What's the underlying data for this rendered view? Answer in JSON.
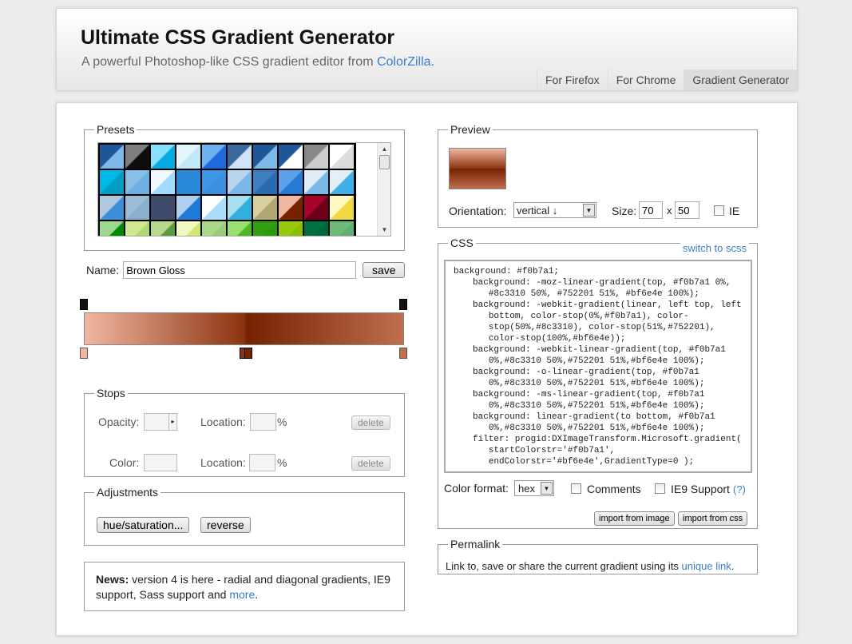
{
  "header": {
    "title": "Ultimate CSS Gradient Generator",
    "subtitle": "A powerful Photoshop-like CSS gradient editor from ",
    "subtitle_link": "ColorZilla",
    "subtitle_end": ".",
    "nav": [
      "For Firefox",
      "For Chrome",
      "Gradient Generator"
    ]
  },
  "presets": {
    "legend": "Presets",
    "swatches": [
      [
        "#1e5799",
        "#7db9e8"
      ],
      [
        "#7d7e7d",
        "#0e0e0e"
      ],
      [
        "#87e0fd",
        "#05abe0"
      ],
      [
        "#e4f5fc",
        "#bfe8f9"
      ],
      [
        "#6db3f2",
        "#1e69de"
      ],
      [
        "#3b679e",
        "#d0e4f7"
      ],
      [
        "#1e5799",
        "#7db9e8"
      ],
      [
        "#1e5799",
        "#ffffff"
      ],
      [
        "#888888",
        "#cccccc"
      ],
      [
        "#ffffff",
        "#dddddd"
      ],
      [
        "#00b7ea",
        "#009ec3"
      ],
      [
        "#88bfe8",
        "#70b0e0"
      ],
      [
        "#f0f9ff",
        "#a1dbff"
      ],
      [
        "#2989d8",
        "#2989d8"
      ],
      [
        "#3c96e8",
        "#3c8ee0"
      ],
      [
        "#b8d4ef",
        "#7ab8e8"
      ],
      [
        "#3b7fc0",
        "#2a6ab0"
      ],
      [
        "#5ba0e8",
        "#2878d8"
      ],
      [
        "#e0ecf8",
        "#7ab8e8"
      ],
      [
        "#e4f0f8",
        "#40b0e8"
      ],
      [
        "#b0c8e0",
        "#3a8ed8"
      ],
      [
        "#9cbdd8",
        "#8ab0d0"
      ],
      [
        "#3e4b6a",
        "#3e4b6a"
      ],
      [
        "#b0d0f0",
        "#1e7ad8"
      ],
      [
        "#ffffff",
        "#a8def8"
      ],
      [
        "#a8e0f0",
        "#30b0e0"
      ],
      [
        "#d8d0a0",
        "#b0a870"
      ],
      [
        "#f0b7a1",
        "#752201"
      ],
      [
        "#a90329",
        "#6d0019"
      ],
      [
        "#fff8c0",
        "#f0d840"
      ],
      [
        "#9dd890",
        "#008a00"
      ],
      [
        "#d0e890",
        "#b0d870"
      ],
      [
        "#b8d890",
        "#5a9a3a"
      ],
      [
        "#f0fac0",
        "#d0e870"
      ],
      [
        "#a8d888",
        "#98cc78"
      ],
      [
        "#98e070",
        "#50b820"
      ],
      [
        "#30a010",
        "#2a9a0a"
      ],
      [
        "#98c808",
        "#88c000"
      ],
      [
        "#007040",
        "#006838"
      ],
      [
        "#6cbc78",
        "#60b070"
      ]
    ]
  },
  "name": {
    "label": "Name:",
    "value": "Brown Gloss",
    "save": "save"
  },
  "gradient": {
    "stops": [
      {
        "color": "#f0b7a1",
        "pos": 0
      },
      {
        "color": "#8c3310",
        "pos": 50
      },
      {
        "color": "#752201",
        "pos": 51
      },
      {
        "color": "#bf6e4e",
        "pos": 100
      }
    ]
  },
  "stops": {
    "legend": "Stops",
    "opacity": "Opacity:",
    "location": "Location:",
    "color": "Color:",
    "pct": "%",
    "delete": "delete"
  },
  "adjustments": {
    "legend": "Adjustments",
    "hue": "hue/saturation...",
    "reverse": "reverse"
  },
  "news": {
    "bold": "News:",
    "text": " version 4 is here - radial and diagonal gradients, IE9 support, Sass support and ",
    "link": "more",
    "end": "."
  },
  "preview": {
    "legend": "Preview",
    "orientation_label": "Orientation:",
    "orientation": "vertical ↓",
    "size_label": "Size:",
    "width": "70",
    "x": "x",
    "height": "50",
    "ie": "IE"
  },
  "css": {
    "legend": "CSS",
    "switch": "switch to scss",
    "code": "background: #f0b7a1;\nbackground: -moz-linear-gradient(top, #f0b7a1 0%,\n   #8c3310 50%, #752201 51%, #bf6e4e 100%);\nbackground: -webkit-gradient(linear, left top, left\n   bottom, color-stop(0%,#f0b7a1), color-\n   stop(50%,#8c3310), color-stop(51%,#752201),\n   color-stop(100%,#bf6e4e));\nbackground: -webkit-linear-gradient(top, #f0b7a1\n   0%,#8c3310 50%,#752201 51%,#bf6e4e 100%);\nbackground: -o-linear-gradient(top, #f0b7a1\n   0%,#8c3310 50%,#752201 51%,#bf6e4e 100%);\nbackground: -ms-linear-gradient(top, #f0b7a1\n   0%,#8c3310 50%,#752201 51%,#bf6e4e 100%);\nbackground: linear-gradient(to bottom, #f0b7a1\n   0%,#8c3310 50%,#752201 51%,#bf6e4e 100%);\nfilter: progid:DXImageTransform.Microsoft.gradient(\n   startColorstr='#f0b7a1',\n   endColorstr='#bf6e4e',GradientType=0 );",
    "format_label": "Color format:",
    "format": "hex",
    "comments": "Comments",
    "ie9": "IE9 Support",
    "help": "(?)",
    "import_image": "import from image",
    "import_css": "import from css"
  },
  "permalink": {
    "legend": "Permalink",
    "text": "Link to, save or share the current gradient using its ",
    "link": "unique link",
    "end": "."
  }
}
